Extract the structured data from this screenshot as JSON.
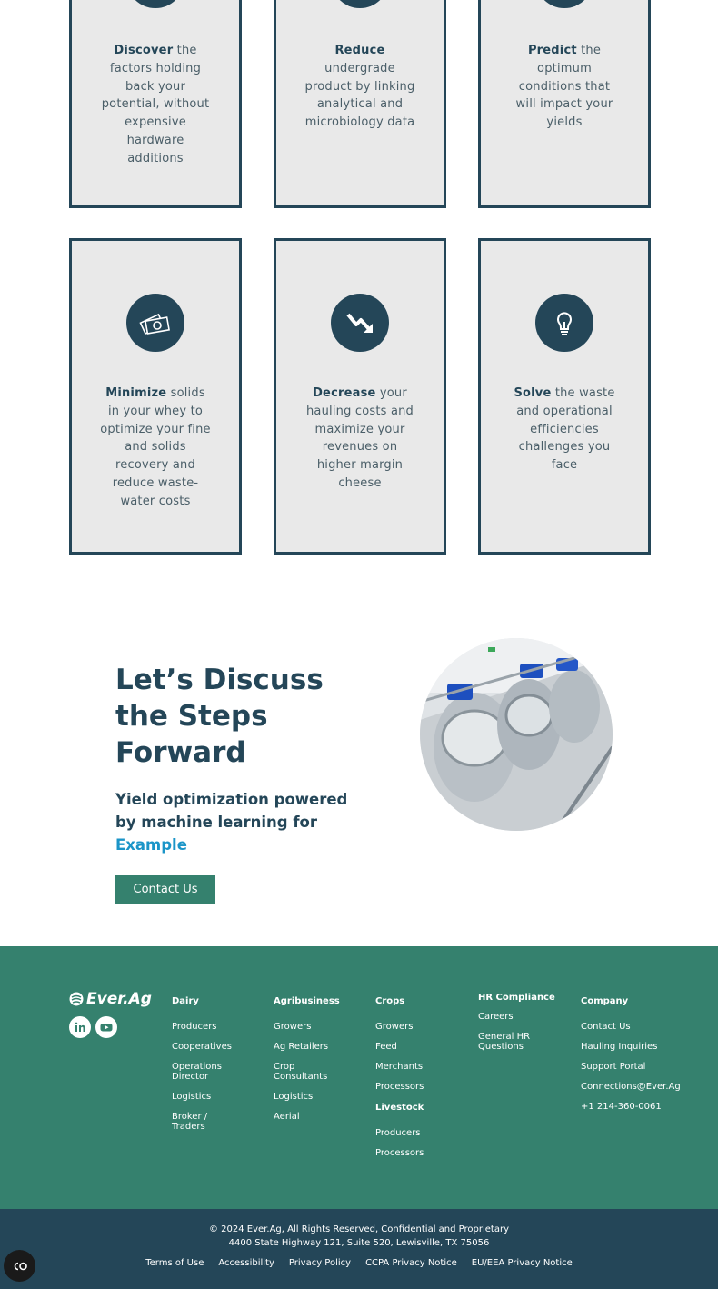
{
  "cards_top": [
    {
      "bold": "Discover",
      "rest": " the factors holding back your potential, without expensive hardware additions"
    },
    {
      "bold": "Reduce",
      "rest": " undergrade product by linking analytical and microbiology data"
    },
    {
      "bold": "Predict",
      "rest": " the optimum conditions that will impact your yields"
    }
  ],
  "cards_bottom": [
    {
      "bold": "Minimize",
      "rest": " solids in your whey to optimize your fine and solids recovery and reduce waste-water costs",
      "icon": "money-icon"
    },
    {
      "bold": "Decrease",
      "rest": " your hauling costs and maximize your revenues on higher margin cheese",
      "icon": "trend-down-icon"
    },
    {
      "bold": "Solve",
      "rest": " the waste and operational efficiencies challenges you face",
      "icon": "lightbulb-icon"
    }
  ],
  "discuss": {
    "title": "Let’s Discuss the Steps Forward",
    "subtitle": "Yield optimization powered by machine learning for",
    "accent": "Example",
    "button": "Contact Us"
  },
  "footer": {
    "logo": "Ever.Ag",
    "columns": [
      {
        "heading": "Dairy",
        "links": [
          "Producers",
          "Cooperatives",
          "Operations Director",
          "Logistics",
          "Broker / Traders"
        ]
      },
      {
        "heading": "Agribusiness",
        "links": [
          "Growers",
          "Ag Retailers",
          "Crop Consultants",
          "Logistics",
          "Aerial"
        ]
      },
      {
        "heading": "Crops",
        "links": [
          "Growers",
          "Feed",
          "Merchants",
          "Processors"
        ]
      },
      {
        "heading": "Livestock",
        "links": [
          "Producers",
          "Processors"
        ]
      },
      {
        "heading": "HR Compliance",
        "links": [
          "Careers",
          "General HR Questions"
        ]
      },
      {
        "heading": "Company",
        "links": [
          "Contact Us",
          "Hauling Inquiries",
          "Support Portal",
          "Connections@Ever.Ag",
          "+1 214-360-0061"
        ]
      }
    ]
  },
  "bottom": {
    "copyright": "© 2024 Ever.Ag, All Rights Reserved, Confidential and Proprietary",
    "address": "4400 State Highway 121, Suite 520, Lewisville, TX 75056",
    "links": [
      "Terms of Use",
      "Accessibility",
      "Privacy Policy",
      "CCPA Privacy Notice",
      "EU/EEA Privacy Notice"
    ]
  },
  "colors": {
    "navy": "#244658",
    "green": "#35816e",
    "accent": "#1b95c8",
    "card_bg": "#e9e9e9"
  }
}
